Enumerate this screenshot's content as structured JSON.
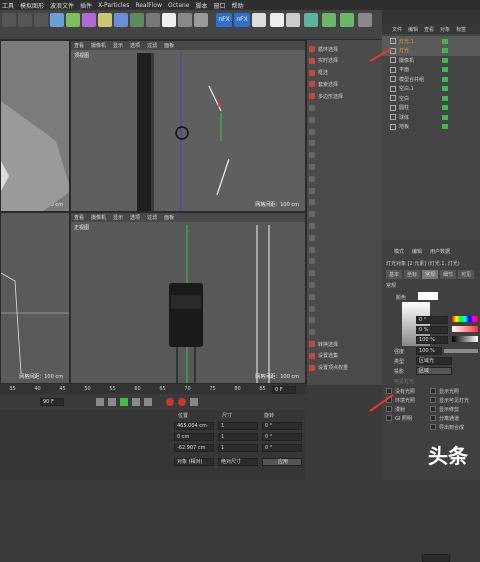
{
  "menubar": {
    "items": [
      "工具",
      "模拟图形",
      "波浪文件",
      "插件",
      "X-Particles",
      "RealFlow",
      "Octane",
      "脚本",
      "窗口",
      "帮助"
    ]
  },
  "toolbar": {
    "nfx1": "nFX",
    "nfx2": "nFX"
  },
  "viewport_menu": [
    "查看",
    "摄像机",
    "显示",
    "选项",
    "过滤",
    "面板"
  ],
  "viewports": {
    "top_name": "顶视图",
    "front_name": "正视图",
    "grid_left": "网格间距：10000 cm",
    "grid_top": "网格间距：100 cm",
    "grid_bl": "网格间距：100 cm",
    "grid_front": "网格间距：100 cm"
  },
  "context_menu": [
    {
      "label": "循环选择",
      "enabled": true
    },
    {
      "label": "实时选择",
      "enabled": true
    },
    {
      "label": "框选",
      "enabled": true
    },
    {
      "label": "套索选择",
      "enabled": true
    },
    {
      "label": "多边形选择",
      "enabled": true
    },
    {
      "label": "",
      "enabled": false
    },
    {
      "label": "",
      "enabled": false
    },
    {
      "label": "",
      "enabled": false
    },
    {
      "label": "",
      "enabled": false
    },
    {
      "label": "",
      "enabled": false
    },
    {
      "label": "",
      "enabled": false
    },
    {
      "label": "",
      "enabled": false
    },
    {
      "label": "",
      "enabled": false
    },
    {
      "label": "",
      "enabled": false
    },
    {
      "label": "",
      "enabled": false
    },
    {
      "label": "",
      "enabled": false
    },
    {
      "label": "",
      "enabled": false
    },
    {
      "label": "",
      "enabled": false
    },
    {
      "label": "",
      "enabled": false
    },
    {
      "label": "",
      "enabled": false
    },
    {
      "label": "",
      "enabled": false
    },
    {
      "label": "",
      "enabled": false
    },
    {
      "label": "",
      "enabled": false
    },
    {
      "label": "",
      "enabled": false
    },
    {
      "label": "",
      "enabled": false
    },
    {
      "label": "转换选择",
      "enabled": true
    },
    {
      "label": "设置选集",
      "enabled": true
    },
    {
      "label": "设置顶点权重",
      "enabled": true
    }
  ],
  "obj_tabs": [
    "文件",
    "编辑",
    "查看",
    "对象",
    "标签"
  ],
  "objects": [
    {
      "name": "灯光.1",
      "color": "#e8a23a"
    },
    {
      "name": "灯光",
      "color": "#e8a23a"
    },
    {
      "name": "摄像机",
      "color": "#cfcfcf"
    },
    {
      "name": "平面",
      "color": "#cfcfcf"
    },
    {
      "name": "模型合并组",
      "color": "#cfcfcf"
    },
    {
      "name": "空白.1",
      "color": "#cfcfcf"
    },
    {
      "name": "空白",
      "color": "#cfcfcf"
    },
    {
      "name": "圆柱",
      "color": "#cfcfcf"
    },
    {
      "name": "球体",
      "color": "#cfcfcf"
    },
    {
      "name": "地板",
      "color": "#cfcfcf"
    }
  ],
  "attributes": {
    "tabs": [
      "模式",
      "编辑",
      "用户数据"
    ],
    "title": "灯光对象 [2 元素] (灯光.1, 灯光)",
    "subtabs": [
      "基本",
      "坐标",
      "常规",
      "细节",
      "可见"
    ],
    "section": "常规",
    "color_label": "颜色",
    "h_val": "0 °",
    "s_val": "0 %",
    "v_val": "100 %",
    "intensity_label": "强度",
    "intensity_val": "100 %",
    "type_label": "类型",
    "type_val": "区域光",
    "shadow_label": "投影",
    "shadow_val": "区域",
    "visible_light_label": "可见灯光",
    "checks": [
      "没有光照",
      "环境光照",
      "漫射",
      "GI 照明",
      "显示光照",
      "显示可见灯光",
      "显示修剪",
      "分离通道",
      "导出到合成"
    ]
  },
  "timeline": {
    "ticks": [
      "35",
      "40",
      "45",
      "50",
      "55",
      "60",
      "65",
      "70",
      "75",
      "80",
      "85",
      "90"
    ],
    "frame": "90 F",
    "end_frame": "0 F"
  },
  "coords": {
    "headers": [
      "位置",
      "尺寸",
      "旋转"
    ],
    "x": "465.004 cm",
    "y": "0 cm",
    "z": "-62.907 cm",
    "sx": "1",
    "sy": "1",
    "sz": "1",
    "h": "0 °",
    "p": "0 °",
    "b": "0 °",
    "mode": "对象 (相对)",
    "size_mode": "绝对尺寸",
    "apply": "应用"
  },
  "watermark": "头条"
}
